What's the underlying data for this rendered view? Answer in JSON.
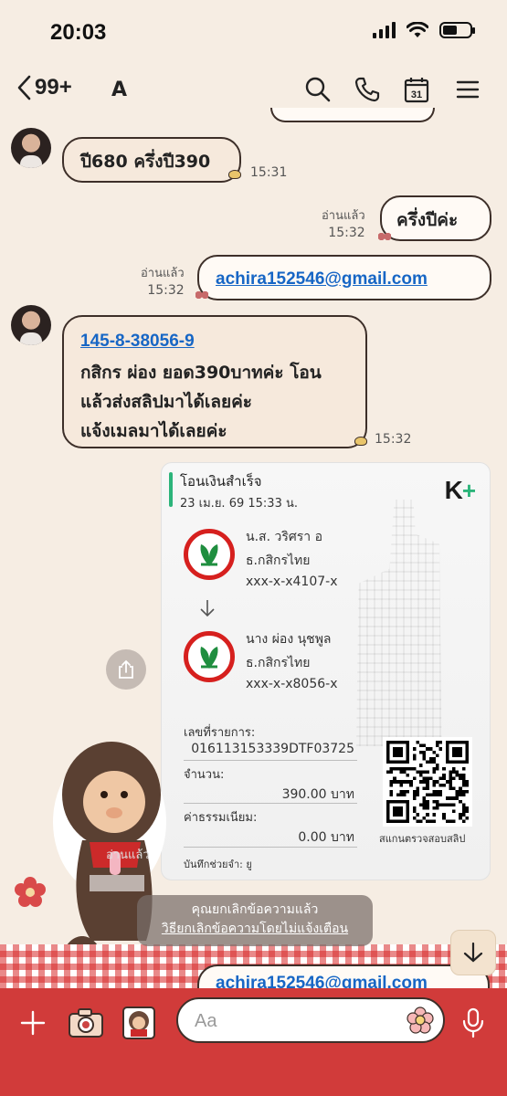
{
  "status_bar": {
    "time": "20:03"
  },
  "header": {
    "unread_count": "99+",
    "title": "A"
  },
  "messages": [
    {
      "text": "ปี680 ครึ่งปี390",
      "time": "15:31"
    },
    {
      "text": "ครึ่งปีค่ะ",
      "read": "อ่านแล้ว",
      "time": "15:32"
    },
    {
      "text": "achira152546@gmail.com",
      "read": "อ่านแล้ว",
      "time": "15:32"
    },
    {
      "link": "145-8-38056-9",
      "lines": [
        "กสิกร ผ่อง ยอด390บาทค่ะ โอน",
        "แล้วส่งสลิปมาได้เลยค่ะ",
        "แจ้งเมลมาได้เลยค่ะ"
      ],
      "time": "15:32"
    }
  ],
  "slip": {
    "title": "โอนเงินสำเร็จ",
    "date": "23 เม.ย. 69  15:33 น.",
    "logo": "K",
    "logo_plus": "+",
    "from": {
      "name": "น.ส. วริศรา อ",
      "bank": "ธ.กสิกรไทย",
      "account": "xxx-x-x4107-x"
    },
    "to": {
      "name": "นาง ผ่อง นุชพูล",
      "bank": "ธ.กสิกรไทย",
      "account": "xxx-x-x8056-x"
    },
    "ref_label": "เลขที่รายการ:",
    "ref_value": "016113153339DTF03725",
    "amount_label": "จำนวน:",
    "amount_value": "390.00 บาท",
    "fee_label": "ค่าธรรมเนียม:",
    "fee_value": "0.00 บาท",
    "qr_caption": "สแกนตรวจสอบสลิป",
    "note": "บันทึกช่วยจำ: ยู"
  },
  "sticker_overlay": {
    "read": "อ่านแล้ว"
  },
  "unsend_notice": {
    "line1": "คุณยกเลิกข้อความแล้ว",
    "line2": "วิธียกเลิกข้อความโดยไม่แจ้งเตือน"
  },
  "ghost_bubble": {
    "text": "achira152546@gmail.com"
  },
  "input_bar": {
    "placeholder": "Aa"
  },
  "colors": {
    "accent_red": "#d13b3a",
    "link_blue": "#1766c5",
    "kplus_green": "#2cb47a",
    "kbank_red": "#d6201e"
  },
  "icons": [
    "chevron-left-icon",
    "search-icon",
    "phone-icon",
    "calendar-icon",
    "menu-icon",
    "share-icon",
    "arrow-down-icon",
    "plus-icon",
    "camera-icon",
    "sticker-icon",
    "emoji-flower-icon",
    "microphone-icon"
  ]
}
